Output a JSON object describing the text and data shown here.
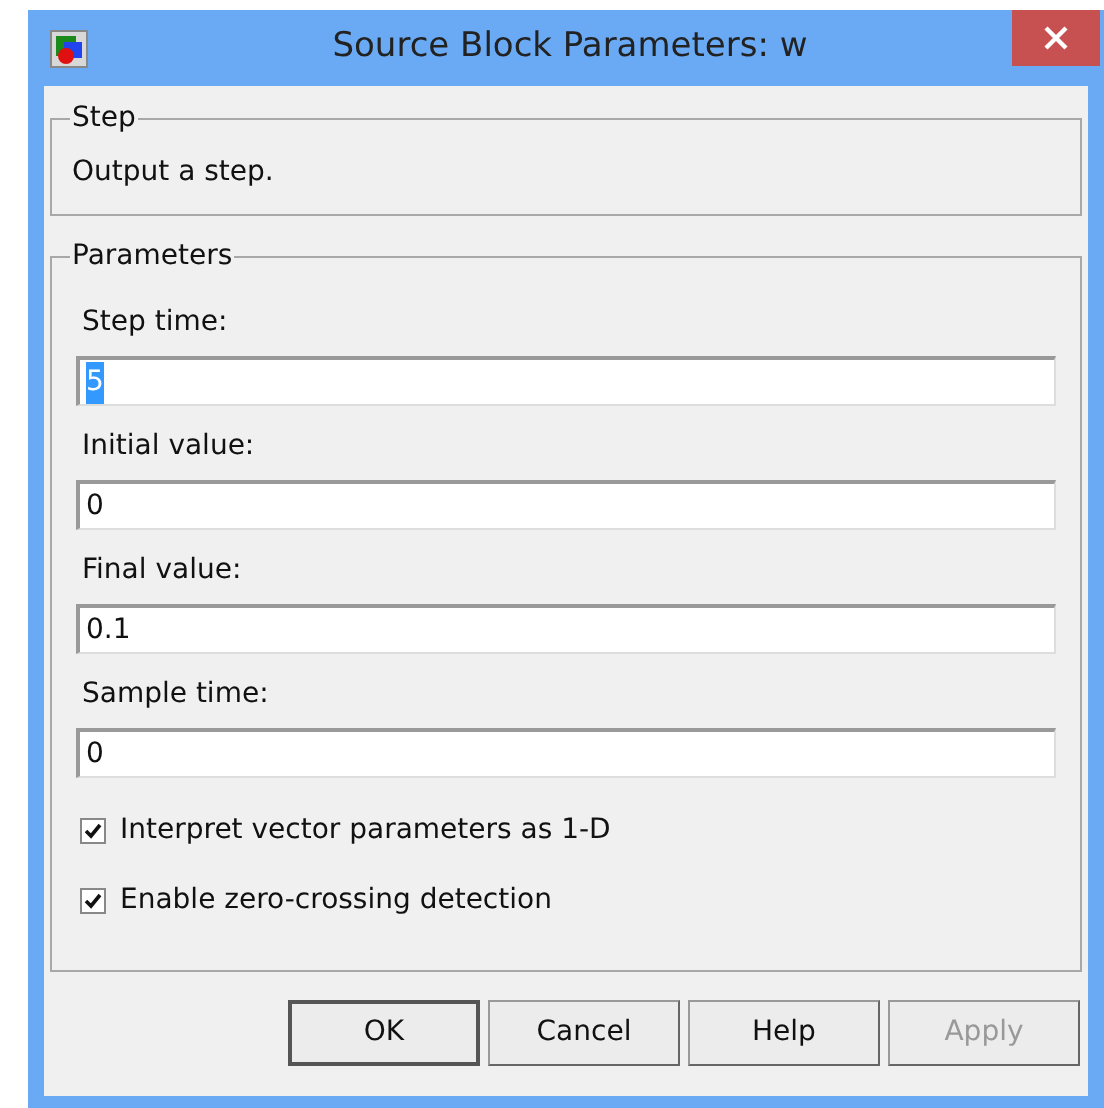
{
  "window": {
    "title": "Source Block Parameters: w"
  },
  "step_group": {
    "title": "Step",
    "description": "Output a step."
  },
  "parameters_group": {
    "title": "Parameters",
    "fields": [
      {
        "label": "Step time:",
        "value": "5",
        "text_selected": true
      },
      {
        "label": "Initial value:",
        "value": "0",
        "text_selected": false
      },
      {
        "label": "Final value:",
        "value": "0.1",
        "text_selected": false
      },
      {
        "label": "Sample time:",
        "value": "0",
        "text_selected": false
      }
    ],
    "checkboxes": [
      {
        "label": "Interpret vector parameters as 1-D",
        "checked": true
      },
      {
        "label": "Enable zero-crossing detection",
        "checked": true
      }
    ]
  },
  "buttons": [
    {
      "label": "OK",
      "default": true,
      "disabled": false
    },
    {
      "label": "Cancel",
      "default": false,
      "disabled": false
    },
    {
      "label": "Help",
      "default": false,
      "disabled": false
    },
    {
      "label": "Apply",
      "default": false,
      "disabled": true
    }
  ]
}
